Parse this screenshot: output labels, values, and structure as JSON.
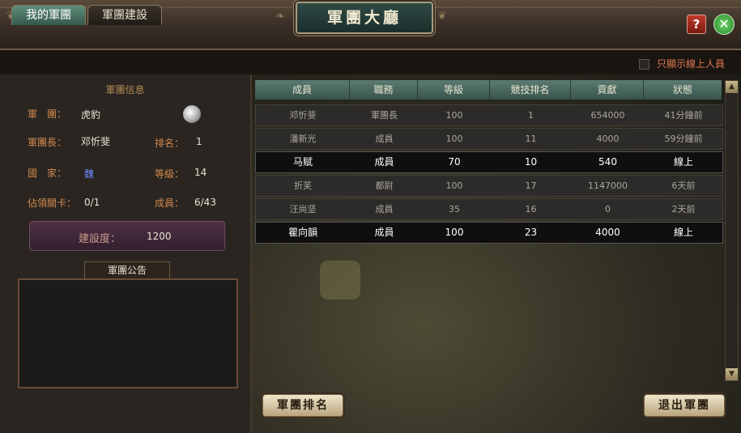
{
  "window": {
    "title": "軍團大廳",
    "help_label": "?",
    "close_label": "✕"
  },
  "tabs": [
    {
      "label": "我的軍團"
    },
    {
      "label": "軍團建設"
    }
  ],
  "online_filter": {
    "label": "只顯示線上人員",
    "checked": false
  },
  "legion_info": {
    "header": "軍團信息",
    "name_label": "軍　團：",
    "name": "虎豹",
    "leader_label": "軍團長：",
    "leader": "邓忻斐",
    "rank_label": "排名：",
    "rank": "1",
    "nation_label": "國　家：",
    "nation": "魏",
    "level_label": "等級：",
    "level": "14",
    "checkpoint_label": "佔領關卡：",
    "checkpoint": "0/1",
    "members_label": "成員：",
    "members": "6/43",
    "construction_label": "建設度：",
    "construction": "1200",
    "emblem_icon": "yin-yang-emblem-icon"
  },
  "notice": {
    "tab_label": "軍團公告",
    "text": ""
  },
  "member_table": {
    "columns": [
      "成員",
      "職務",
      "等級",
      "競技排名",
      "貢獻",
      "狀態"
    ],
    "rows": [
      {
        "name": "邓忻斐",
        "role": "軍團長",
        "level": "100",
        "rank": "1",
        "contrib": "654000",
        "status": "41分鐘前",
        "online": false
      },
      {
        "name": "潘新光",
        "role": "成員",
        "level": "100",
        "rank": "11",
        "contrib": "4000",
        "status": "59分鐘前",
        "online": false
      },
      {
        "name": "马赋",
        "role": "成員",
        "level": "70",
        "rank": "10",
        "contrib": "540",
        "status": "線上",
        "online": true
      },
      {
        "name": "折芙",
        "role": "都尉",
        "level": "100",
        "rank": "17",
        "contrib": "1147000",
        "status": "6天前",
        "online": false
      },
      {
        "name": "汪尚坚",
        "role": "成員",
        "level": "35",
        "rank": "16",
        "contrib": "0",
        "status": "2天前",
        "online": false
      },
      {
        "name": "瞿向韻",
        "role": "成員",
        "level": "100",
        "rank": "23",
        "contrib": "4000",
        "status": "線上",
        "online": true
      }
    ]
  },
  "buttons": {
    "legion_rank": "軍團排名",
    "leave_legion": "退出軍團"
  },
  "colors": {
    "accent_teal": "#4c6e63",
    "label_orange": "#d48a50",
    "nation_blue": "#6f8cff"
  }
}
